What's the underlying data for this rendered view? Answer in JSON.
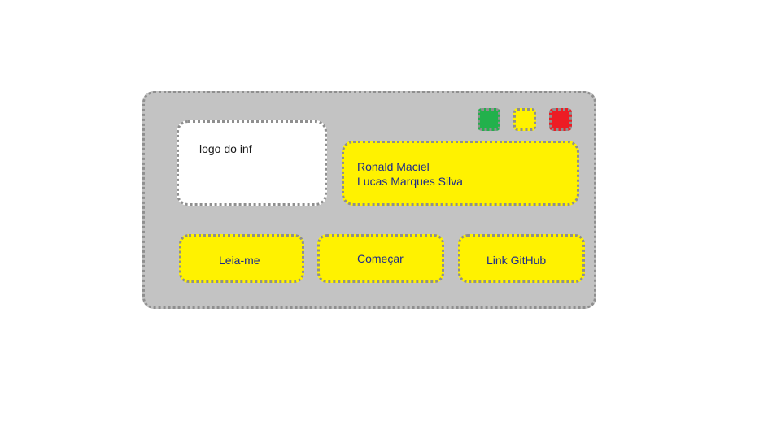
{
  "window_controls": [
    {
      "name": "maximize",
      "color": "#22b14c"
    },
    {
      "name": "minimize",
      "color": "#fff200"
    },
    {
      "name": "close",
      "color": "#ed1c24"
    }
  ],
  "logo": {
    "label": "logo do inf"
  },
  "authors": [
    "Ronald Maciel",
    "Lucas Marques Silva"
  ],
  "buttons": {
    "readme_label": "Leia-me",
    "start_label": "Começar",
    "github_label": "Link GitHub"
  }
}
